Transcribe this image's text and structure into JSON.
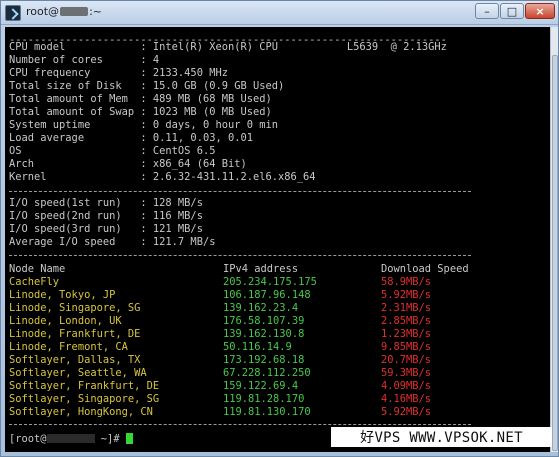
{
  "window": {
    "title_prefix": "root@",
    "title_suffix": ":~"
  },
  "sysinfo": {
    "separator": "----------------------------------------------------------------------",
    "rows": [
      {
        "label": "CPU model           ",
        "value": ": Intel(R) Xeon(R) CPU           L5639  @ 2.13GHz"
      },
      {
        "label": "Number of cores     ",
        "value": ": 4"
      },
      {
        "label": "CPU frequency       ",
        "value": ": 2133.450 MHz"
      },
      {
        "label": "Total size of Disk  ",
        "value": ": 15.0 GB (0.9 GB Used)"
      },
      {
        "label": "Total amount of Mem ",
        "value": ": 489 MB (68 MB Used)"
      },
      {
        "label": "Total amount of Swap",
        "value": ": 1023 MB (0 MB Used)"
      },
      {
        "label": "System uptime       ",
        "value": ": 0 days, 0 hour 0 min"
      },
      {
        "label": "Load average        ",
        "value": ": 0.11, 0.03, 0.01"
      },
      {
        "label": "OS                  ",
        "value": ": CentOS 6.5"
      },
      {
        "label": "Arch                ",
        "value": ": x86_64 (64 Bit)"
      },
      {
        "label": "Kernel              ",
        "value": ": 2.6.32-431.11.2.el6.x86_64"
      }
    ]
  },
  "io": {
    "rows": [
      {
        "label": "I/O speed(1st run)  ",
        "value": ": 128 MB/s"
      },
      {
        "label": "I/O speed(2nd run)  ",
        "value": ": 116 MB/s"
      },
      {
        "label": "I/O speed(3rd run)  ",
        "value": ": 121 MB/s"
      },
      {
        "label": "Average I/O speed   ",
        "value": ": 121.7 MB/s"
      }
    ]
  },
  "speedtest": {
    "headers": {
      "node": "Node Name",
      "ip": "IPv4 address",
      "speed": "Download Speed"
    },
    "rows": [
      {
        "node": "CacheFly",
        "ip": "205.234.175.175",
        "speed": "58.9MB/s"
      },
      {
        "node": "Linode, Tokyo, JP",
        "ip": "106.187.96.148",
        "speed": "5.92MB/s"
      },
      {
        "node": "Linode, Singapore, SG",
        "ip": "139.162.23.4",
        "speed": "2.31MB/s"
      },
      {
        "node": "Linode, London, UK",
        "ip": "176.58.107.39",
        "speed": "2.85MB/s"
      },
      {
        "node": "Linode, Frankfurt, DE",
        "ip": "139.162.130.8",
        "speed": "1.23MB/s"
      },
      {
        "node": "Linode, Fremont, CA",
        "ip": "50.116.14.9",
        "speed": "9.85MB/s"
      },
      {
        "node": "Softlayer, Dallas, TX",
        "ip": "173.192.68.18",
        "speed": "20.7MB/s"
      },
      {
        "node": "Softlayer, Seattle, WA",
        "ip": "67.228.112.250",
        "speed": "59.3MB/s"
      },
      {
        "node": "Softlayer, Frankfurt, DE",
        "ip": "159.122.69.4",
        "speed": "4.09MB/s"
      },
      {
        "node": "Softlayer, Singapore, SG",
        "ip": "119.81.28.170",
        "speed": "4.16MB/s"
      },
      {
        "node": "Softlayer, HongKong, CN",
        "ip": "119.81.130.170",
        "speed": "5.92MB/s"
      }
    ]
  },
  "prompt": {
    "prefix": "[root@",
    "suffix": " ~]# "
  },
  "watermark": "好VPS WWW.VPSOK.NET",
  "colors": {
    "node": "#d6c53d",
    "ip": "#48c84b",
    "speed": "#e02f2f",
    "cursor": "#36d633"
  }
}
